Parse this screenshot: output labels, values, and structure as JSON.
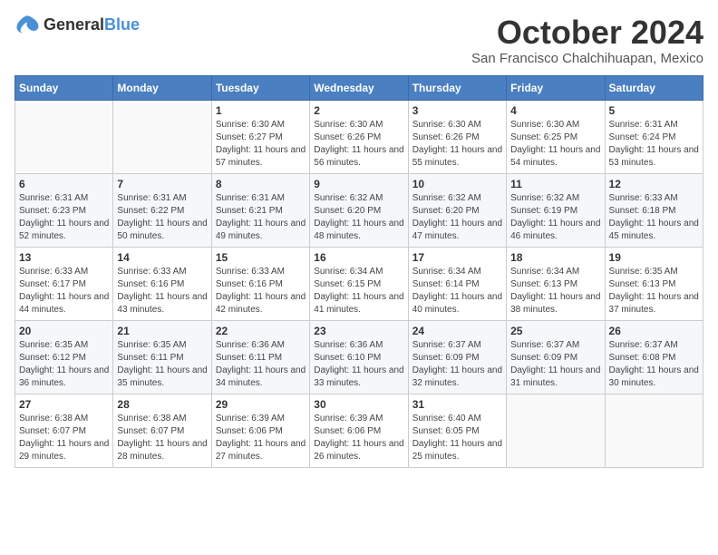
{
  "logo": {
    "general": "General",
    "blue": "Blue"
  },
  "title": "October 2024",
  "location": "San Francisco Chalchihuapan, Mexico",
  "weekdays": [
    "Sunday",
    "Monday",
    "Tuesday",
    "Wednesday",
    "Thursday",
    "Friday",
    "Saturday"
  ],
  "weeks": [
    [
      {
        "day": "",
        "info": ""
      },
      {
        "day": "",
        "info": ""
      },
      {
        "day": "1",
        "info": "Sunrise: 6:30 AM\nSunset: 6:27 PM\nDaylight: 11 hours and 57 minutes."
      },
      {
        "day": "2",
        "info": "Sunrise: 6:30 AM\nSunset: 6:26 PM\nDaylight: 11 hours and 56 minutes."
      },
      {
        "day": "3",
        "info": "Sunrise: 6:30 AM\nSunset: 6:26 PM\nDaylight: 11 hours and 55 minutes."
      },
      {
        "day": "4",
        "info": "Sunrise: 6:30 AM\nSunset: 6:25 PM\nDaylight: 11 hours and 54 minutes."
      },
      {
        "day": "5",
        "info": "Sunrise: 6:31 AM\nSunset: 6:24 PM\nDaylight: 11 hours and 53 minutes."
      }
    ],
    [
      {
        "day": "6",
        "info": "Sunrise: 6:31 AM\nSunset: 6:23 PM\nDaylight: 11 hours and 52 minutes."
      },
      {
        "day": "7",
        "info": "Sunrise: 6:31 AM\nSunset: 6:22 PM\nDaylight: 11 hours and 50 minutes."
      },
      {
        "day": "8",
        "info": "Sunrise: 6:31 AM\nSunset: 6:21 PM\nDaylight: 11 hours and 49 minutes."
      },
      {
        "day": "9",
        "info": "Sunrise: 6:32 AM\nSunset: 6:20 PM\nDaylight: 11 hours and 48 minutes."
      },
      {
        "day": "10",
        "info": "Sunrise: 6:32 AM\nSunset: 6:20 PM\nDaylight: 11 hours and 47 minutes."
      },
      {
        "day": "11",
        "info": "Sunrise: 6:32 AM\nSunset: 6:19 PM\nDaylight: 11 hours and 46 minutes."
      },
      {
        "day": "12",
        "info": "Sunrise: 6:33 AM\nSunset: 6:18 PM\nDaylight: 11 hours and 45 minutes."
      }
    ],
    [
      {
        "day": "13",
        "info": "Sunrise: 6:33 AM\nSunset: 6:17 PM\nDaylight: 11 hours and 44 minutes."
      },
      {
        "day": "14",
        "info": "Sunrise: 6:33 AM\nSunset: 6:16 PM\nDaylight: 11 hours and 43 minutes."
      },
      {
        "day": "15",
        "info": "Sunrise: 6:33 AM\nSunset: 6:16 PM\nDaylight: 11 hours and 42 minutes."
      },
      {
        "day": "16",
        "info": "Sunrise: 6:34 AM\nSunset: 6:15 PM\nDaylight: 11 hours and 41 minutes."
      },
      {
        "day": "17",
        "info": "Sunrise: 6:34 AM\nSunset: 6:14 PM\nDaylight: 11 hours and 40 minutes."
      },
      {
        "day": "18",
        "info": "Sunrise: 6:34 AM\nSunset: 6:13 PM\nDaylight: 11 hours and 38 minutes."
      },
      {
        "day": "19",
        "info": "Sunrise: 6:35 AM\nSunset: 6:13 PM\nDaylight: 11 hours and 37 minutes."
      }
    ],
    [
      {
        "day": "20",
        "info": "Sunrise: 6:35 AM\nSunset: 6:12 PM\nDaylight: 11 hours and 36 minutes."
      },
      {
        "day": "21",
        "info": "Sunrise: 6:35 AM\nSunset: 6:11 PM\nDaylight: 11 hours and 35 minutes."
      },
      {
        "day": "22",
        "info": "Sunrise: 6:36 AM\nSunset: 6:11 PM\nDaylight: 11 hours and 34 minutes."
      },
      {
        "day": "23",
        "info": "Sunrise: 6:36 AM\nSunset: 6:10 PM\nDaylight: 11 hours and 33 minutes."
      },
      {
        "day": "24",
        "info": "Sunrise: 6:37 AM\nSunset: 6:09 PM\nDaylight: 11 hours and 32 minutes."
      },
      {
        "day": "25",
        "info": "Sunrise: 6:37 AM\nSunset: 6:09 PM\nDaylight: 11 hours and 31 minutes."
      },
      {
        "day": "26",
        "info": "Sunrise: 6:37 AM\nSunset: 6:08 PM\nDaylight: 11 hours and 30 minutes."
      }
    ],
    [
      {
        "day": "27",
        "info": "Sunrise: 6:38 AM\nSunset: 6:07 PM\nDaylight: 11 hours and 29 minutes."
      },
      {
        "day": "28",
        "info": "Sunrise: 6:38 AM\nSunset: 6:07 PM\nDaylight: 11 hours and 28 minutes."
      },
      {
        "day": "29",
        "info": "Sunrise: 6:39 AM\nSunset: 6:06 PM\nDaylight: 11 hours and 27 minutes."
      },
      {
        "day": "30",
        "info": "Sunrise: 6:39 AM\nSunset: 6:06 PM\nDaylight: 11 hours and 26 minutes."
      },
      {
        "day": "31",
        "info": "Sunrise: 6:40 AM\nSunset: 6:05 PM\nDaylight: 11 hours and 25 minutes."
      },
      {
        "day": "",
        "info": ""
      },
      {
        "day": "",
        "info": ""
      }
    ]
  ]
}
